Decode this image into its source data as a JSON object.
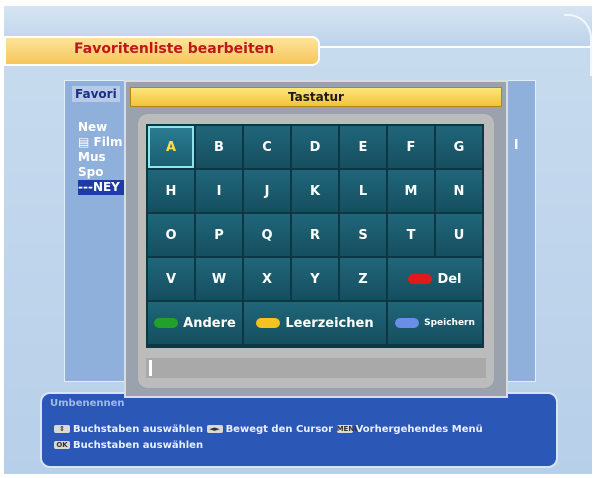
{
  "header": {
    "title": "Favoritenliste bearbeiten"
  },
  "favorites": {
    "label": "Favori",
    "items": [
      "New",
      "Film",
      "Mus",
      "Spo",
      "---NEY"
    ],
    "side_letter": "l"
  },
  "dialog": {
    "title": "Tastatur",
    "keys": [
      "A",
      "B",
      "C",
      "D",
      "E",
      "F",
      "G",
      "H",
      "I",
      "J",
      "K",
      "L",
      "M",
      "N",
      "O",
      "P",
      "Q",
      "R",
      "S",
      "T",
      "U",
      "V",
      "W",
      "X",
      "Y",
      "Z"
    ],
    "selected_key": "A",
    "del_label": "Del",
    "andere_label": "Andere",
    "space_label": "Leerzeichen",
    "save_label": "Speichern",
    "input_value": ""
  },
  "status": {
    "title": "Umbenennen",
    "help1": "Buchstaben auswählen",
    "help2": "Bewegt den Cursor",
    "menu_icon": "MENU",
    "help3": "Vorhergehendes Menü",
    "ok_icon": "OK",
    "help4": "Buchstaben auswählen"
  },
  "colors": {
    "red": "#e01a1a",
    "green": "#1fa12a",
    "yellow": "#f4c320",
    "blue": "#6a8ee8"
  }
}
